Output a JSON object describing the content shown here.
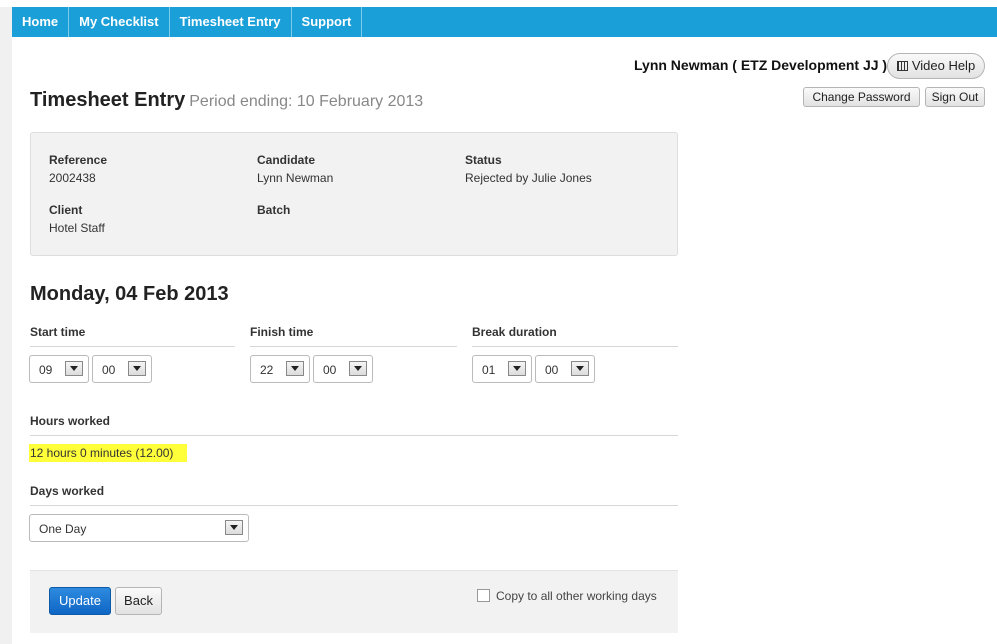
{
  "nav": {
    "items": [
      "Home",
      "My Checklist",
      "Timesheet Entry",
      "Support"
    ]
  },
  "user": {
    "name": "Lynn Newman ( ETZ Development JJ )"
  },
  "buttons": {
    "video_help": "Video Help",
    "change_password": "Change Password",
    "sign_out": "Sign Out",
    "update": "Update",
    "back": "Back"
  },
  "page": {
    "title": "Timesheet Entry",
    "period": "Period ending: 10 February 2013"
  },
  "info": {
    "reference_label": "Reference",
    "reference": "2002438",
    "candidate_label": "Candidate",
    "candidate": "Lynn Newman",
    "status_label": "Status",
    "status": "Rejected by Julie Jones",
    "client_label": "Client",
    "client": "Hotel Staff",
    "batch_label": "Batch",
    "batch": ""
  },
  "day": {
    "title": "Monday, 04 Feb 2013"
  },
  "start": {
    "label": "Start time",
    "hour": "09",
    "minute": "00"
  },
  "finish": {
    "label": "Finish time",
    "hour": "22",
    "minute": "00"
  },
  "break": {
    "label": "Break duration",
    "hour": "01",
    "minute": "00"
  },
  "hours": {
    "label": "Hours worked",
    "value": "12 hours 0 minutes (12.00)"
  },
  "days": {
    "label": "Days worked",
    "value": "One Day"
  },
  "copy": {
    "label": "Copy to all other working days",
    "checked": false
  },
  "colors": {
    "nav": "#1a9fd8",
    "highlight": "#ffff3a",
    "primary_button": "#1a73d0"
  }
}
